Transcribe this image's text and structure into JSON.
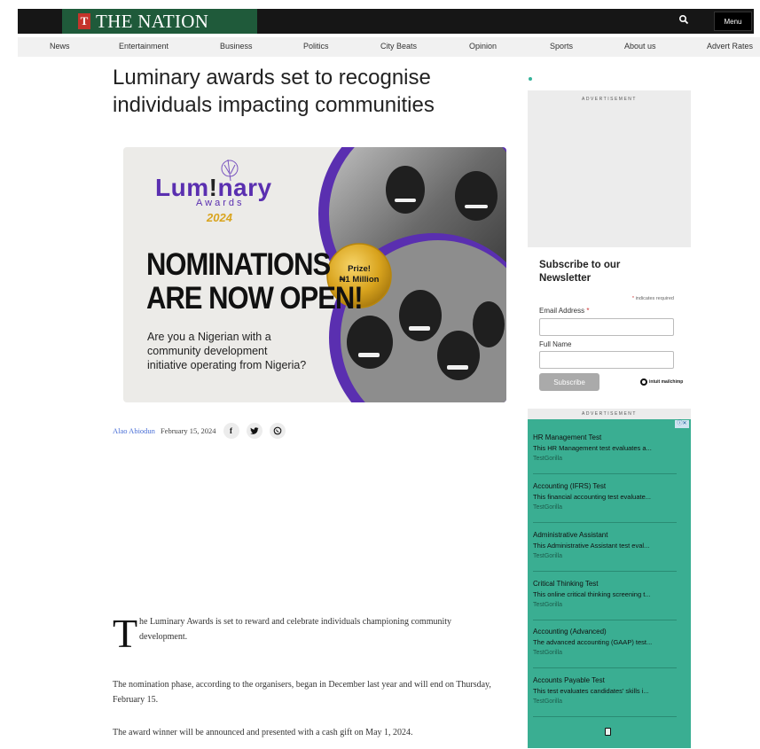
{
  "header": {
    "logo_mark": "T",
    "logo_text": "THE NATION",
    "menu_label": "Menu"
  },
  "nav": {
    "items": [
      "News",
      "Entertainment",
      "Business",
      "Politics",
      "City Beats",
      "Opinion",
      "Sports",
      "About us",
      "Advert Rates"
    ]
  },
  "article": {
    "headline": "Luminary awards set to recognise individuals impacting communities",
    "author": "Alao Abiodun",
    "date": "February 15, 2024",
    "share_icons": [
      "facebook-icon",
      "twitter-icon",
      "whatsapp-icon"
    ],
    "dropcap": "T",
    "para1": "he Luminary Awards is set to reward and celebrate individuals championing community development.",
    "para2": "The nomination phase, according to the organisers, began in December last year and will end on Thursday, February 15.",
    "para3": "The award winner will be announced and presented with a cash gift on May 1, 2024."
  },
  "banner": {
    "brand_part1": "Lum",
    "brand_part2": "nary",
    "brand_sub": "Awards",
    "year": "2024",
    "heading_line1": "NOMINATIONS",
    "heading_line2": "ARE NOW OPEN!",
    "prize_line1": "Prize!",
    "prize_line2": "₦1 Million",
    "question": "Are you a Nigerian with a community development initiative operating from Nigeria?",
    "colors": {
      "purple": "#5a2fb0",
      "gold": "#d9a41e",
      "background": "#ecebe8"
    }
  },
  "sidebar": {
    "ad_label": "ADVERTISEMENT",
    "newsletter": {
      "title": "Subscribe to our Newsletter",
      "required_marker": "*",
      "required_note": "indicates required",
      "email_label": "Email Address",
      "name_label": "Full Name",
      "subscribe_label": "Subscribe",
      "brand": "intuit mailchimp"
    },
    "ad2": {
      "label": "ADVERTISEMENT",
      "close": "ⓘ✕",
      "items": [
        {
          "title": "HR Management Test",
          "desc": "This HR Management test evaluates a...",
          "source": "TestGorilla"
        },
        {
          "title": "Accounting (IFRS) Test",
          "desc": "This financial accounting test evaluate...",
          "source": "TestGorilla"
        },
        {
          "title": "Administrative Assistant",
          "desc": "This Administrative Assistant test eval...",
          "source": "TestGorilla"
        },
        {
          "title": "Critical Thinking Test",
          "desc": "This online critical thinking screening t...",
          "source": "TestGorilla"
        },
        {
          "title": "Accounting (Advanced)",
          "desc": "The advanced accounting (GAAP) test...",
          "source": "TestGorilla"
        },
        {
          "title": "Accounts Payable Test",
          "desc": "This test evaluates candidates' skills i...",
          "source": "TestGorilla"
        }
      ],
      "background": "#3aae92"
    }
  }
}
